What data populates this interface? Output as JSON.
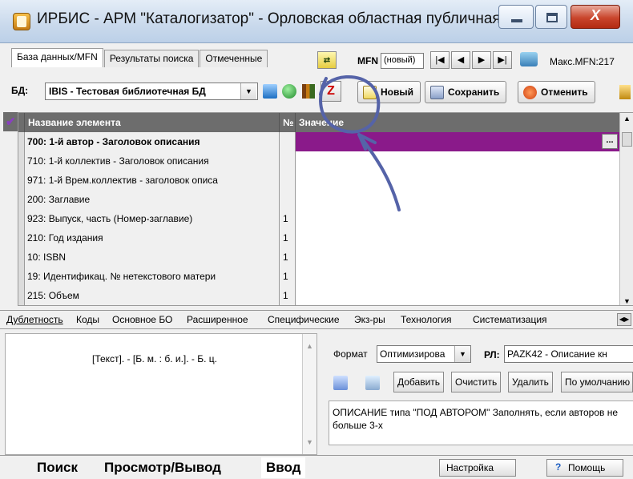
{
  "window": {
    "title": "ИРБИС - АРМ \"Каталогизатор\" - Орловская областная публичная ...",
    "controls": [
      "minimize-icon",
      "maximize-icon",
      "close-icon"
    ],
    "close_glyph": "X"
  },
  "top_tabs": [
    {
      "label": "База данных/MFN"
    },
    {
      "label": "Результаты поиска"
    },
    {
      "label": "Отмеченные"
    }
  ],
  "mfn": {
    "label": "MFN",
    "value": "(новый)"
  },
  "max_mfn": "Макс.MFN:217",
  "db": {
    "label": "БД:",
    "value": "IBIS - Тестовая библиотечная БД"
  },
  "z_button": "Z",
  "actions": {
    "new": "Новый",
    "save": "Сохранить",
    "cancel": "Отменить"
  },
  "grid": {
    "headers": {
      "name": "Название элемента",
      "num": "№",
      "value": "Значение"
    },
    "ellipsis": "...",
    "rows": [
      {
        "name": "700: 1-й  автор - Заголовок описания",
        "num": "",
        "selected": true
      },
      {
        "name": "710: 1-й коллектив - Заголовок описания",
        "num": ""
      },
      {
        "name": "971: 1-й Врем.коллектив - заголовок описа",
        "num": ""
      },
      {
        "name": "200: Заглавие",
        "num": ""
      },
      {
        "name": "923: Выпуск, часть (Номер-заглавие)",
        "num": "1"
      },
      {
        "name": "210: Год издания",
        "num": "1"
      },
      {
        "name": "10: ISBN",
        "num": "1"
      },
      {
        "name": "19: Идентификац. № нетекстового матери",
        "num": "1"
      },
      {
        "name": "215: Объем",
        "num": "1"
      }
    ]
  },
  "bottom_tabs": [
    "Дублетность",
    "Коды",
    "Основное БО",
    "Расширенное",
    "Специфические",
    "Экз-ры",
    "Технология",
    "Систематизация"
  ],
  "preview": {
    "text": "[Текст]. - [Б. м. : б. и.]. - Б. ц."
  },
  "format": {
    "label": "Формат",
    "value": "Оптимизирова"
  },
  "rl": {
    "label": "РЛ:",
    "value": "PAZK42 - Описание кн"
  },
  "rl_buttons": [
    "Добавить",
    "Очистить",
    "Удалить",
    "По умолчанию"
  ],
  "description": "ОПИСАНИЕ типа \"ПОД АВТОРОМ\"    Заполнять, если авторов не больше 3-х",
  "modes": [
    "Поиск",
    "Просмотр/Вывод",
    "Ввод"
  ],
  "status_buttons": {
    "settings": "Настройка",
    "help": "Помощь",
    "help_glyph": "?"
  },
  "colors": {
    "selected_value": "#8a1a8a",
    "header_bg": "#6d6d6d",
    "annotation": "#5563a8",
    "z_red": "#cc0000",
    "check_purple": "#8a3fc2"
  }
}
